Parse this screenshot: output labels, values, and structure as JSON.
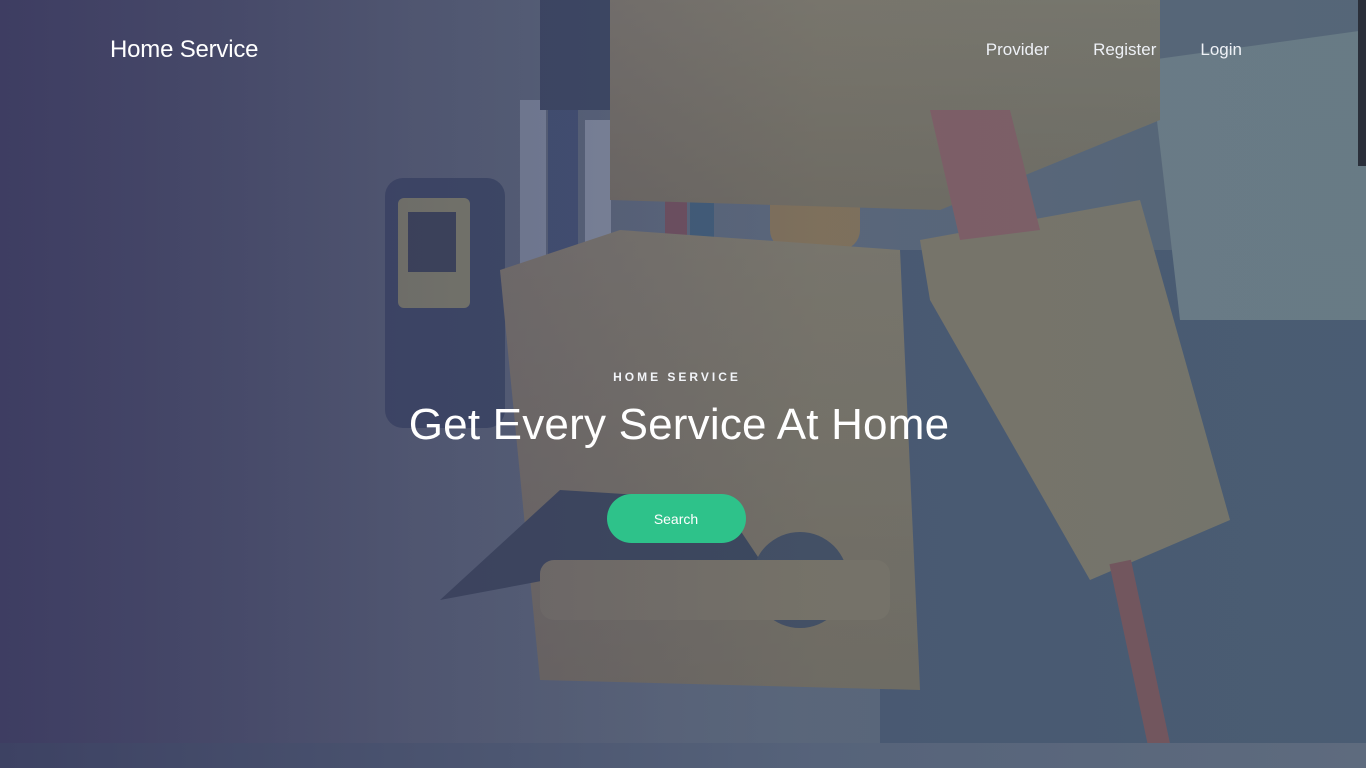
{
  "header": {
    "brand": "Home Service",
    "nav": [
      {
        "label": "Provider"
      },
      {
        "label": "Register"
      },
      {
        "label": "Login"
      }
    ]
  },
  "hero": {
    "eyebrow": "HOME SERVICE",
    "headline": "Get Every Service At Home",
    "search_label": "Search"
  },
  "colors": {
    "accent": "#2ec28a",
    "overlay": "#3a3860"
  }
}
